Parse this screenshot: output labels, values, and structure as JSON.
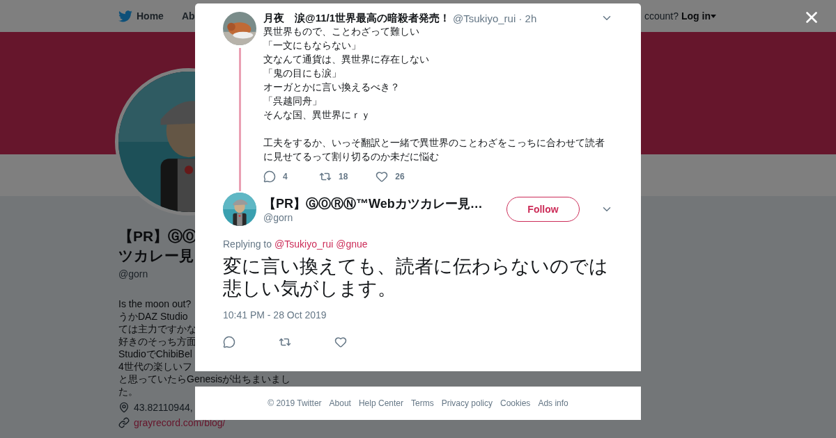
{
  "nav": {
    "items": [
      {
        "label": "Home",
        "kind": "home"
      },
      {
        "label": "Ab",
        "kind": "text"
      }
    ],
    "account_prompt": "ccount?",
    "login": "Log in"
  },
  "profile": {
    "name_lines": [
      "【PR】ⒼⓄ",
      "ツカレー見"
    ],
    "handle": "@gorn",
    "bio_lines": [
      "Is the moon out?",
      "うかDAZ Studio",
      "ては主力ですかな",
      "好きのそっち方面",
      "StudioでChibiBel",
      "4世代の楽しいフ",
      "と思っていたらGenesisが出ちまいまし",
      "た。"
    ],
    "location": "43.82110944,",
    "link": "grayrecord.com/blog/"
  },
  "modal": {
    "parent_tweet": {
      "name": "月夜　涙@11/1世界最高の暗殺者発売！",
      "handle_time": "@Tsukiyo_rui · 2h",
      "paragraphs": [
        [
          "異世界もので、ことわざって難しい",
          "「一文にもならない」",
          "文なんて通貨は、異世界に存在しない",
          "「鬼の目にも涙」",
          "オーガとかに言い換えるべき？",
          "「呉越同舟」",
          "そんな国、異世界にｒｙ"
        ],
        [
          "工夫をするか、いっそ翻訳と一緒で異世界のことわざをこっちに合わせて読者",
          "に見せてるって割り切るのか未だに悩む"
        ]
      ],
      "actions": [
        {
          "kind": "reply",
          "count": "4"
        },
        {
          "kind": "retweet",
          "count": "18"
        },
        {
          "kind": "like",
          "count": "26"
        }
      ]
    },
    "tweet": {
      "name": "【PR】ⒼⓄⓇⓃ™Webカツカレー見…",
      "handle": "@gorn",
      "follow": "Follow",
      "replying_label": "Replying to",
      "mentions": [
        "@Tsukiyo_rui",
        "@gnue"
      ],
      "text_lines": [
        "変に言い換えても、読者に伝わらないのでは",
        "悲しい気がします。"
      ],
      "timestamp": "10:41 PM - 28 Oct 2019",
      "actions": [
        {
          "kind": "reply"
        },
        {
          "kind": "retweet"
        },
        {
          "kind": "like"
        }
      ]
    },
    "footer": [
      "© 2019 Twitter",
      "About",
      "Help Center",
      "Terms",
      "Privacy policy",
      "Cookies",
      "Ads info"
    ]
  }
}
